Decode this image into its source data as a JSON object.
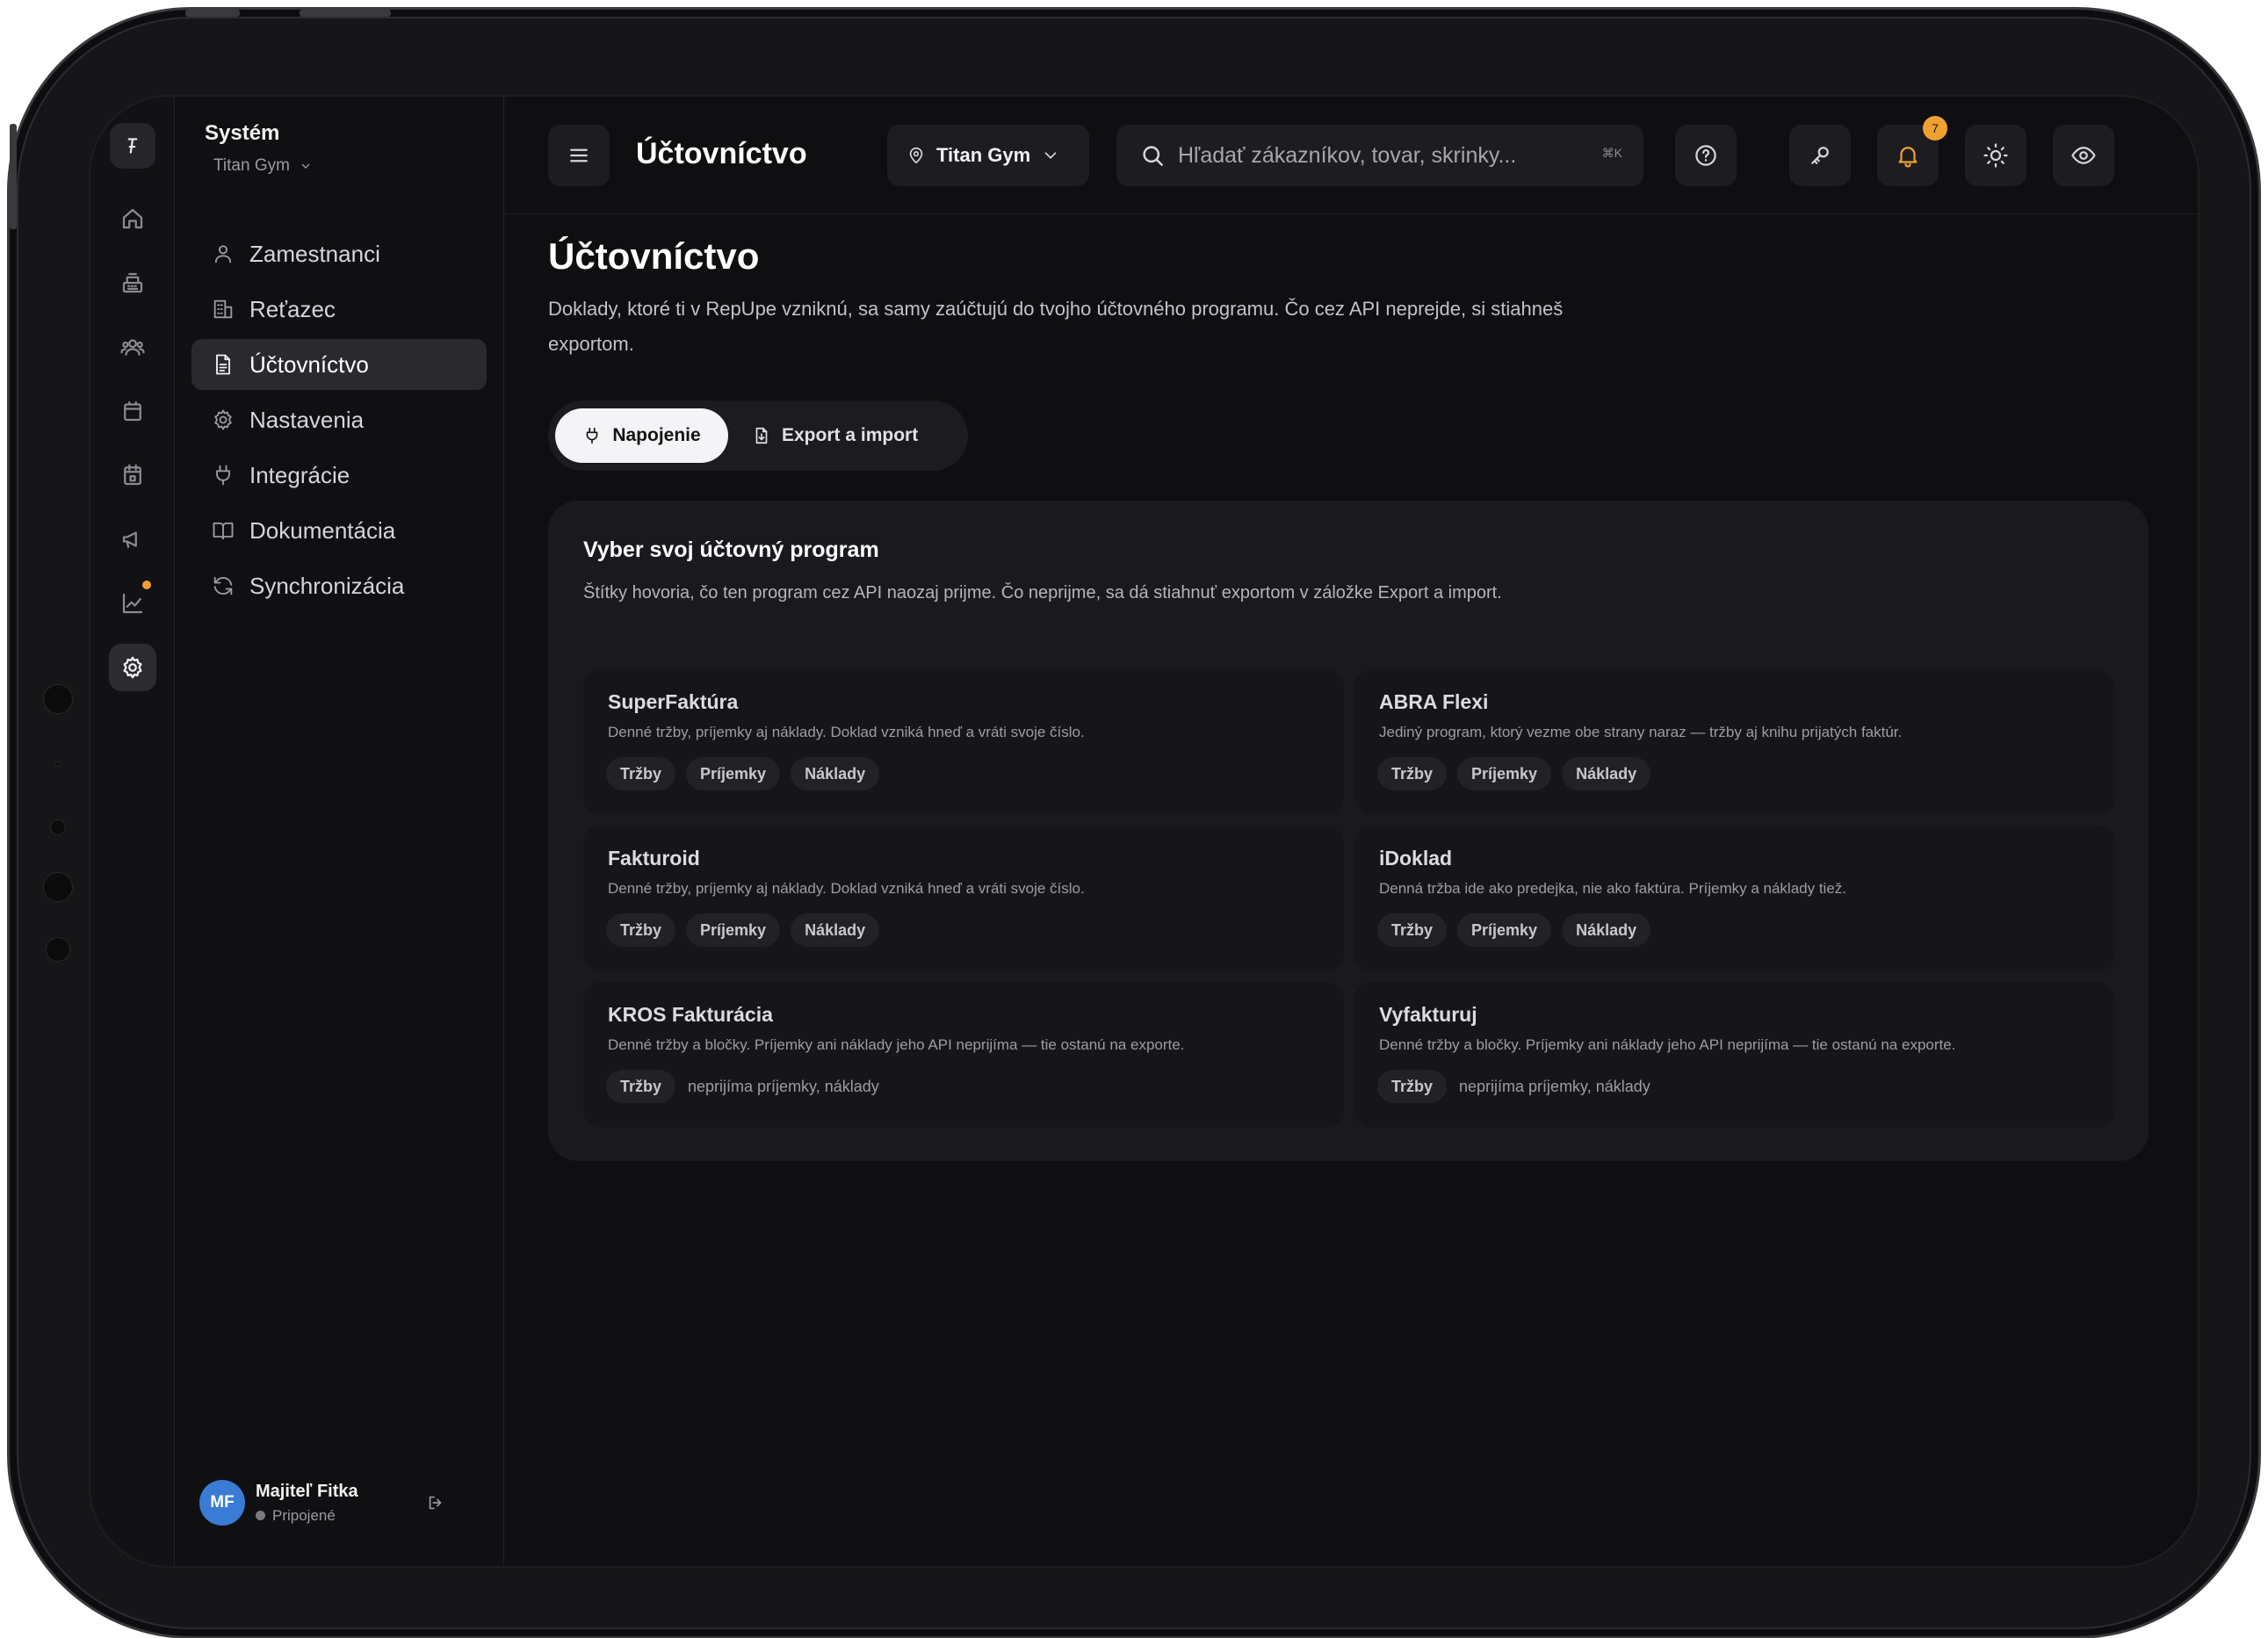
{
  "sidebar": {
    "title": "Systém",
    "gym": "Titan Gym",
    "items": [
      {
        "label": "Zamestnanci",
        "icon": "user-icon"
      },
      {
        "label": "Reťazec",
        "icon": "building-icon"
      },
      {
        "label": "Účtovníctvo",
        "icon": "document-icon"
      },
      {
        "label": "Nastavenia",
        "icon": "gear-icon"
      },
      {
        "label": "Integrácie",
        "icon": "plug-icon"
      },
      {
        "label": "Dokumentácia",
        "icon": "book-icon"
      },
      {
        "label": "Synchronizácia",
        "icon": "refresh-icon"
      }
    ],
    "active_index": 2,
    "user": {
      "initials": "MF",
      "name": "Majiteľ Fitka",
      "status": "Pripojené"
    }
  },
  "topbar": {
    "title": "Účtovníctvo",
    "location": "Titan Gym",
    "search_placeholder": "Hľadať zákazníkov, tovar, skrinky...",
    "shortcut": "⌘K",
    "notification_count": "7"
  },
  "main": {
    "title": "Účtovníctvo",
    "description": "Doklady, ktoré ti v RepUpe vzniknú, sa samy zaúčtujú do tvojho účtovného programu. Čo cez API neprejde, si stiahneš exportom.",
    "tabs": [
      {
        "label": "Napojenie",
        "icon": "plug-icon",
        "active": true
      },
      {
        "label": "Export a import",
        "icon": "file-transfer-icon",
        "active": false
      }
    ],
    "panel": {
      "title": "Vyber svoj účtovný program",
      "description": "Štítky hovoria, čo ten program cez API naozaj prijme. Čo neprijme, sa dá stiahnuť exportom v záložke Export a import.",
      "programs": [
        {
          "name": "SuperFaktúra",
          "desc": "Denné tržby, príjemky aj náklady. Doklad vzniká hneď a vráti svoje číslo.",
          "tags": [
            "Tržby",
            "Príjemky",
            "Náklady"
          ],
          "note": ""
        },
        {
          "name": "ABRA Flexi",
          "desc": "Jediný program, ktorý vezme obe strany naraz — tržby aj knihu prijatých faktúr.",
          "tags": [
            "Tržby",
            "Príjemky",
            "Náklady"
          ],
          "note": ""
        },
        {
          "name": "Fakturoid",
          "desc": "Denné tržby, príjemky aj náklady. Doklad vzniká hneď a vráti svoje číslo.",
          "tags": [
            "Tržby",
            "Príjemky",
            "Náklady"
          ],
          "note": ""
        },
        {
          "name": "iDoklad",
          "desc": "Denná tržba ide ako predejka, nie ako faktúra. Príjemky a náklady tiež.",
          "tags": [
            "Tržby",
            "Príjemky",
            "Náklady"
          ],
          "note": ""
        },
        {
          "name": "KROS Fakturácia",
          "desc": "Denné tržby a bločky. Príjemky ani náklady jeho API neprijíma — tie ostanú na exporte.",
          "tags": [
            "Tržby"
          ],
          "note": "neprijíma príjemky, náklady"
        },
        {
          "name": "Vyfakturuj",
          "desc": "Denné tržby a bločky. Príjemky ani náklady jeho API neprijíma — tie ostanú na exporte.",
          "tags": [
            "Tržby"
          ],
          "note": "neprijíma príjemky, náklady"
        }
      ]
    }
  },
  "colors": {
    "accent": "#f0a030",
    "avatar": "#3a7bd5",
    "background": "#0f0f11",
    "panel": "#1a1a1e"
  }
}
